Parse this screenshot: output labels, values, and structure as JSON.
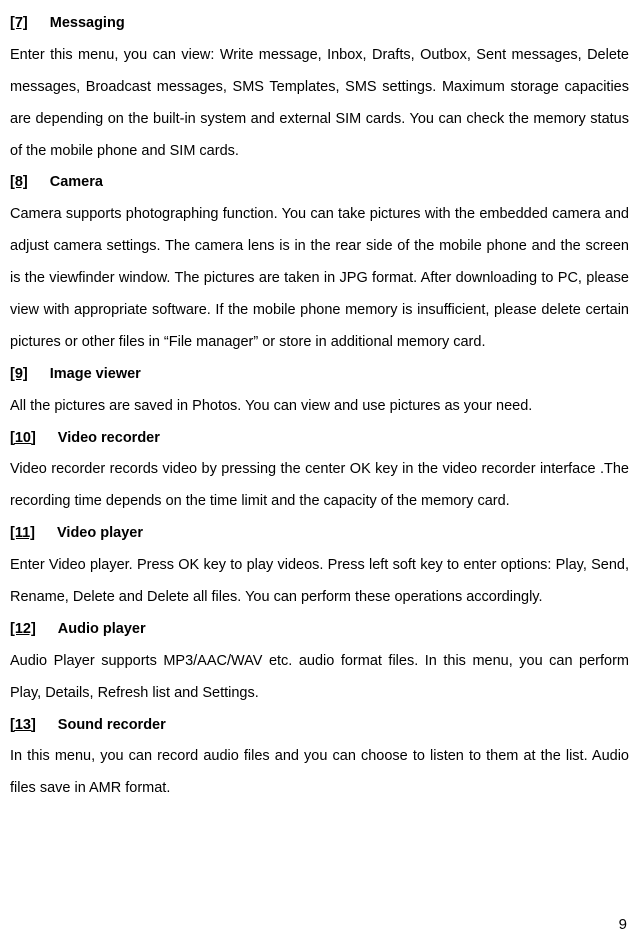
{
  "sections": [
    {
      "num": "[7]",
      "title": "Messaging",
      "body": "Enter this menu, you can view: Write message, Inbox, Drafts, Outbox, Sent messages, Delete messages, Broadcast messages, SMS Templates, SMS settings. Maximum storage capacities are depending on the built-in system and external SIM cards. You can check the memory status of the mobile phone and SIM cards."
    },
    {
      "num": "[8]",
      "title": "Camera",
      "body": "Camera supports photographing function. You can take pictures with the embedded camera and adjust camera settings. The camera lens is in the rear side of the mobile phone and the screen is the viewfinder window. The pictures are taken in JPG format. After downloading to PC, please view with appropriate software. If the mobile phone memory is insufficient, please delete certain pictures or other files in “File manager” or store in additional memory card."
    },
    {
      "num": "[9]",
      "title": "Image viewer",
      "body": "All the pictures are saved in Photos. You can view and use pictures as your need."
    },
    {
      "num": "[10]",
      "title": "Video recorder",
      "body": "Video recorder records video by pressing the center OK key in the video recorder interface .The recording time depends on the time limit and the capacity of the memory card."
    },
    {
      "num": "[11]",
      "title": "Video player",
      "body": "Enter Video player. Press OK key to play videos. Press left soft key to enter options: Play, Send, Rename, Delete and Delete all files. You can perform these operations accordingly."
    },
    {
      "num": "[12]",
      "title": "Audio player",
      "body": "Audio Player supports MP3/AAC/WAV etc. audio format files. In this menu, you can perform Play, Details, Refresh list and Settings."
    },
    {
      "num": "[13]",
      "title": "Sound recorder",
      "body": "In this menu, you can record audio files and you can choose to listen to them at the list. Audio files save in AMR format."
    }
  ],
  "page_number": "9"
}
